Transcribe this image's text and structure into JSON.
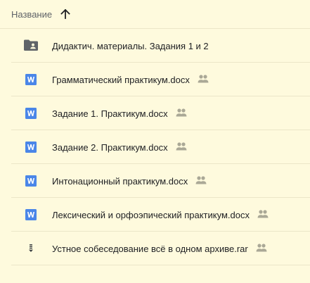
{
  "header": {
    "name_label": "Название",
    "sort_icon": "arrow-up-icon"
  },
  "colors": {
    "background": "#fefadd",
    "divider": "#ebe6c8",
    "word_blue": "#4a86e8",
    "folder_gray": "#5f6368",
    "shared_icon": "#aaa896"
  },
  "files": [
    {
      "name": "Дидактич. материалы. Задания 1 и 2",
      "type": "shared-folder",
      "shared": false
    },
    {
      "name": "Грамматический практикум.docx",
      "type": "word",
      "shared": true
    },
    {
      "name": "Задание 1. Практикум.docx",
      "type": "word",
      "shared": true
    },
    {
      "name": "Задание 2. Практикум.docx",
      "type": "word",
      "shared": true
    },
    {
      "name": "Интонационный практикум.docx",
      "type": "word",
      "shared": true
    },
    {
      "name": "Лексический и орфоэпический практикум.docx",
      "type": "word",
      "shared": true
    },
    {
      "name": "Устное собеседование всё в одном архиве.rar",
      "type": "archive",
      "shared": true
    }
  ]
}
